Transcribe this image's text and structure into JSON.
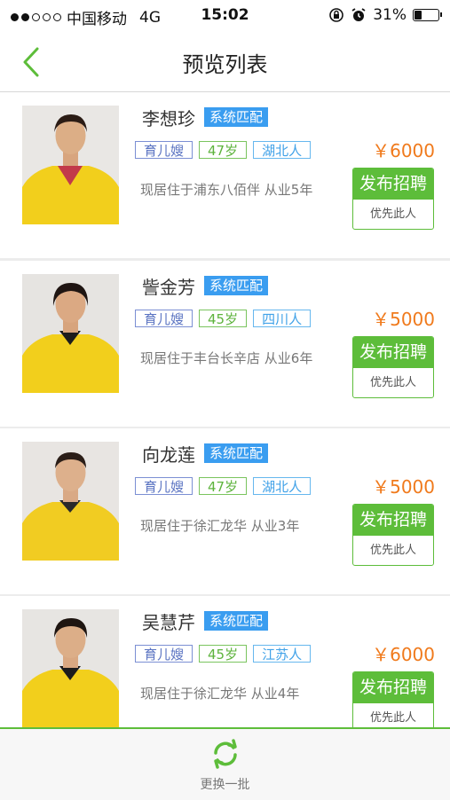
{
  "status_bar": {
    "carrier": "中国移动",
    "network": "4G",
    "time": "15:02",
    "battery": "31%",
    "battery_level": 0.31,
    "signal_bars": 2
  },
  "navbar": {
    "title": "预览列表",
    "back_icon": "chevron-left-icon"
  },
  "colors": {
    "accent_green": "#5dbd3a",
    "match_blue": "#3a9df0",
    "salary_orange": "#f07a1c"
  },
  "candidates": [
    {
      "name": "李想珍",
      "match": "系统匹配",
      "role": "育儿嫂",
      "age": "47岁",
      "origin": "湖北人",
      "salary": "￥6000",
      "location": "现居住于浦东八佰伴 从业5年",
      "button_primary": "发布招聘",
      "button_secondary": "优先此人"
    },
    {
      "name": "訾金芳",
      "match": "系统匹配",
      "role": "育儿嫂",
      "age": "45岁",
      "origin": "四川人",
      "salary": "￥5000",
      "location": "现居住于丰台长辛店 从业6年",
      "button_primary": "发布招聘",
      "button_secondary": "优先此人"
    },
    {
      "name": "向龙莲",
      "match": "系统匹配",
      "role": "育儿嫂",
      "age": "47岁",
      "origin": "湖北人",
      "salary": "￥5000",
      "location": "现居住于徐汇龙华 从业3年",
      "button_primary": "发布招聘",
      "button_secondary": "优先此人"
    },
    {
      "name": "吴慧芹",
      "match": "系统匹配",
      "role": "育儿嫂",
      "age": "45岁",
      "origin": "江苏人",
      "salary": "￥6000",
      "location": "现居住于徐汇龙华 从业4年",
      "button_primary": "发布招聘",
      "button_secondary": "优先此人"
    }
  ],
  "bottom_bar": {
    "refresh_label": "更换一批",
    "refresh_icon": "refresh-icon"
  }
}
